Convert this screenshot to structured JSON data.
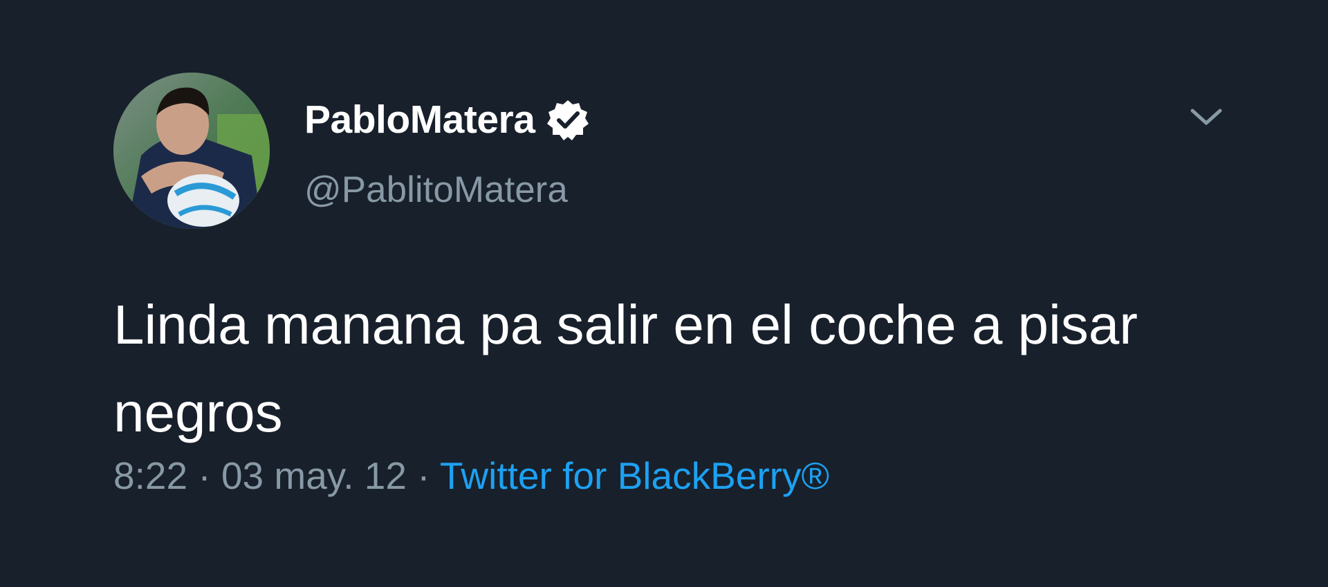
{
  "author": {
    "display_name": "PabloMatera",
    "handle": "@PablitoMatera",
    "verified": true
  },
  "tweet": {
    "text": "Linda manana pa salir en el coche a pisar negros",
    "time": "8:22",
    "date": "03 may. 12",
    "separator": " · ",
    "source": "Twitter for BlackBerry®"
  },
  "icons": {
    "verified": "verified-badge-icon",
    "menu": "chevron-down-icon"
  },
  "colors": {
    "background": "#18202b",
    "text": "#ffffff",
    "secondary": "#8899a6",
    "link": "#1da1f2"
  }
}
